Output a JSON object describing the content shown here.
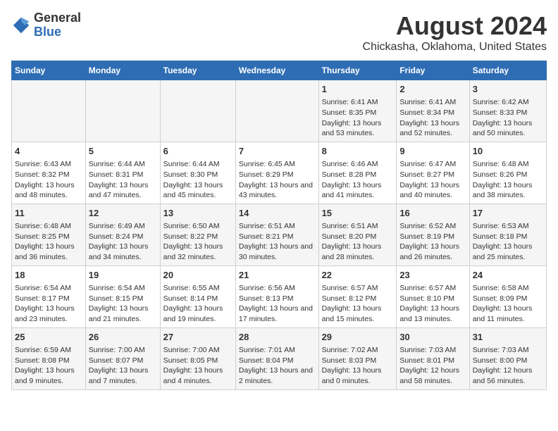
{
  "logo": {
    "general": "General",
    "blue": "Blue"
  },
  "title": "August 2024",
  "subtitle": "Chickasha, Oklahoma, United States",
  "days_of_week": [
    "Sunday",
    "Monday",
    "Tuesday",
    "Wednesday",
    "Thursday",
    "Friday",
    "Saturday"
  ],
  "weeks": [
    [
      {
        "day": "",
        "content": ""
      },
      {
        "day": "",
        "content": ""
      },
      {
        "day": "",
        "content": ""
      },
      {
        "day": "",
        "content": ""
      },
      {
        "day": "1",
        "content": "Sunrise: 6:41 AM\nSunset: 8:35 PM\nDaylight: 13 hours and 53 minutes."
      },
      {
        "day": "2",
        "content": "Sunrise: 6:41 AM\nSunset: 8:34 PM\nDaylight: 13 hours and 52 minutes."
      },
      {
        "day": "3",
        "content": "Sunrise: 6:42 AM\nSunset: 8:33 PM\nDaylight: 13 hours and 50 minutes."
      }
    ],
    [
      {
        "day": "4",
        "content": "Sunrise: 6:43 AM\nSunset: 8:32 PM\nDaylight: 13 hours and 48 minutes."
      },
      {
        "day": "5",
        "content": "Sunrise: 6:44 AM\nSunset: 8:31 PM\nDaylight: 13 hours and 47 minutes."
      },
      {
        "day": "6",
        "content": "Sunrise: 6:44 AM\nSunset: 8:30 PM\nDaylight: 13 hours and 45 minutes."
      },
      {
        "day": "7",
        "content": "Sunrise: 6:45 AM\nSunset: 8:29 PM\nDaylight: 13 hours and 43 minutes."
      },
      {
        "day": "8",
        "content": "Sunrise: 6:46 AM\nSunset: 8:28 PM\nDaylight: 13 hours and 41 minutes."
      },
      {
        "day": "9",
        "content": "Sunrise: 6:47 AM\nSunset: 8:27 PM\nDaylight: 13 hours and 40 minutes."
      },
      {
        "day": "10",
        "content": "Sunrise: 6:48 AM\nSunset: 8:26 PM\nDaylight: 13 hours and 38 minutes."
      }
    ],
    [
      {
        "day": "11",
        "content": "Sunrise: 6:48 AM\nSunset: 8:25 PM\nDaylight: 13 hours and 36 minutes."
      },
      {
        "day": "12",
        "content": "Sunrise: 6:49 AM\nSunset: 8:24 PM\nDaylight: 13 hours and 34 minutes."
      },
      {
        "day": "13",
        "content": "Sunrise: 6:50 AM\nSunset: 8:22 PM\nDaylight: 13 hours and 32 minutes."
      },
      {
        "day": "14",
        "content": "Sunrise: 6:51 AM\nSunset: 8:21 PM\nDaylight: 13 hours and 30 minutes."
      },
      {
        "day": "15",
        "content": "Sunrise: 6:51 AM\nSunset: 8:20 PM\nDaylight: 13 hours and 28 minutes."
      },
      {
        "day": "16",
        "content": "Sunrise: 6:52 AM\nSunset: 8:19 PM\nDaylight: 13 hours and 26 minutes."
      },
      {
        "day": "17",
        "content": "Sunrise: 6:53 AM\nSunset: 8:18 PM\nDaylight: 13 hours and 25 minutes."
      }
    ],
    [
      {
        "day": "18",
        "content": "Sunrise: 6:54 AM\nSunset: 8:17 PM\nDaylight: 13 hours and 23 minutes."
      },
      {
        "day": "19",
        "content": "Sunrise: 6:54 AM\nSunset: 8:15 PM\nDaylight: 13 hours and 21 minutes."
      },
      {
        "day": "20",
        "content": "Sunrise: 6:55 AM\nSunset: 8:14 PM\nDaylight: 13 hours and 19 minutes."
      },
      {
        "day": "21",
        "content": "Sunrise: 6:56 AM\nSunset: 8:13 PM\nDaylight: 13 hours and 17 minutes."
      },
      {
        "day": "22",
        "content": "Sunrise: 6:57 AM\nSunset: 8:12 PM\nDaylight: 13 hours and 15 minutes."
      },
      {
        "day": "23",
        "content": "Sunrise: 6:57 AM\nSunset: 8:10 PM\nDaylight: 13 hours and 13 minutes."
      },
      {
        "day": "24",
        "content": "Sunrise: 6:58 AM\nSunset: 8:09 PM\nDaylight: 13 hours and 11 minutes."
      }
    ],
    [
      {
        "day": "25",
        "content": "Sunrise: 6:59 AM\nSunset: 8:08 PM\nDaylight: 13 hours and 9 minutes."
      },
      {
        "day": "26",
        "content": "Sunrise: 7:00 AM\nSunset: 8:07 PM\nDaylight: 13 hours and 7 minutes."
      },
      {
        "day": "27",
        "content": "Sunrise: 7:00 AM\nSunset: 8:05 PM\nDaylight: 13 hours and 4 minutes."
      },
      {
        "day": "28",
        "content": "Sunrise: 7:01 AM\nSunset: 8:04 PM\nDaylight: 13 hours and 2 minutes."
      },
      {
        "day": "29",
        "content": "Sunrise: 7:02 AM\nSunset: 8:03 PM\nDaylight: 13 hours and 0 minutes."
      },
      {
        "day": "30",
        "content": "Sunrise: 7:03 AM\nSunset: 8:01 PM\nDaylight: 12 hours and 58 minutes."
      },
      {
        "day": "31",
        "content": "Sunrise: 7:03 AM\nSunset: 8:00 PM\nDaylight: 12 hours and 56 minutes."
      }
    ]
  ]
}
